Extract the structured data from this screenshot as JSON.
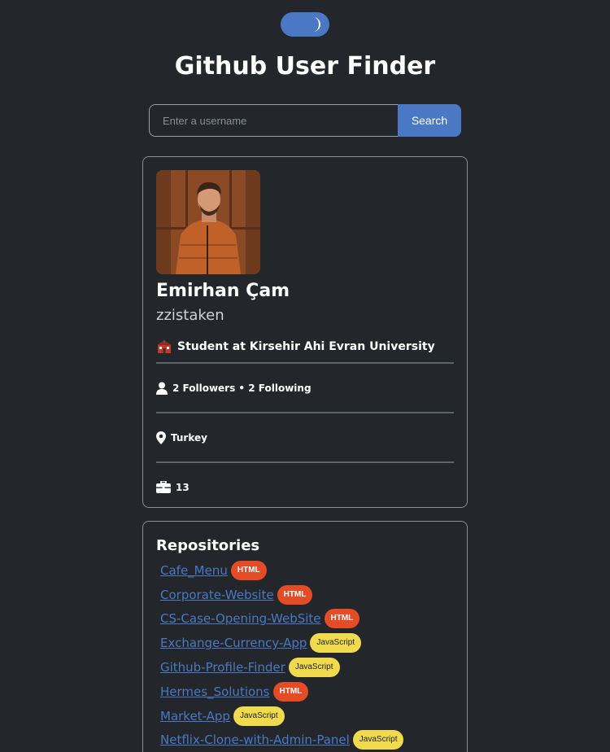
{
  "app": {
    "title": "Github User Finder"
  },
  "theme_toggle": {
    "icon": "moon-icon",
    "accent": "#4a78c4"
  },
  "search": {
    "placeholder": "Enter a username",
    "value": "",
    "button_label": "Search"
  },
  "profile": {
    "avatar_icon": "user-photo",
    "name": "Emirhan Çam",
    "login": "zzistaken",
    "bio_icon": "school-icon",
    "bio": "Student at Kirsehir Ahi Evran University",
    "followers_text": "2 Followers • 2 Following",
    "location": "Turkey",
    "public_repos": "13"
  },
  "repositories": {
    "heading": "Repositories",
    "items": [
      {
        "name": "Cafe_Menu",
        "language": "HTML"
      },
      {
        "name": "Corporate-Website",
        "language": "HTML"
      },
      {
        "name": "CS-Case-Opening-WebSite",
        "language": "HTML"
      },
      {
        "name": "Exchange-Currency-App",
        "language": "JavaScript"
      },
      {
        "name": "Github-Profile-Finder",
        "language": "JavaScript"
      },
      {
        "name": "Hermes_Solutions",
        "language": "HTML"
      },
      {
        "name": "Market-App",
        "language": "JavaScript"
      },
      {
        "name": "Netflix-Clone-with-Admin-Panel",
        "language": "JavaScript"
      }
    ]
  },
  "colors": {
    "background": "#23272b",
    "accent": "#4a78c4",
    "html_badge": "#e34c26",
    "js_badge": "#f0db4f"
  }
}
